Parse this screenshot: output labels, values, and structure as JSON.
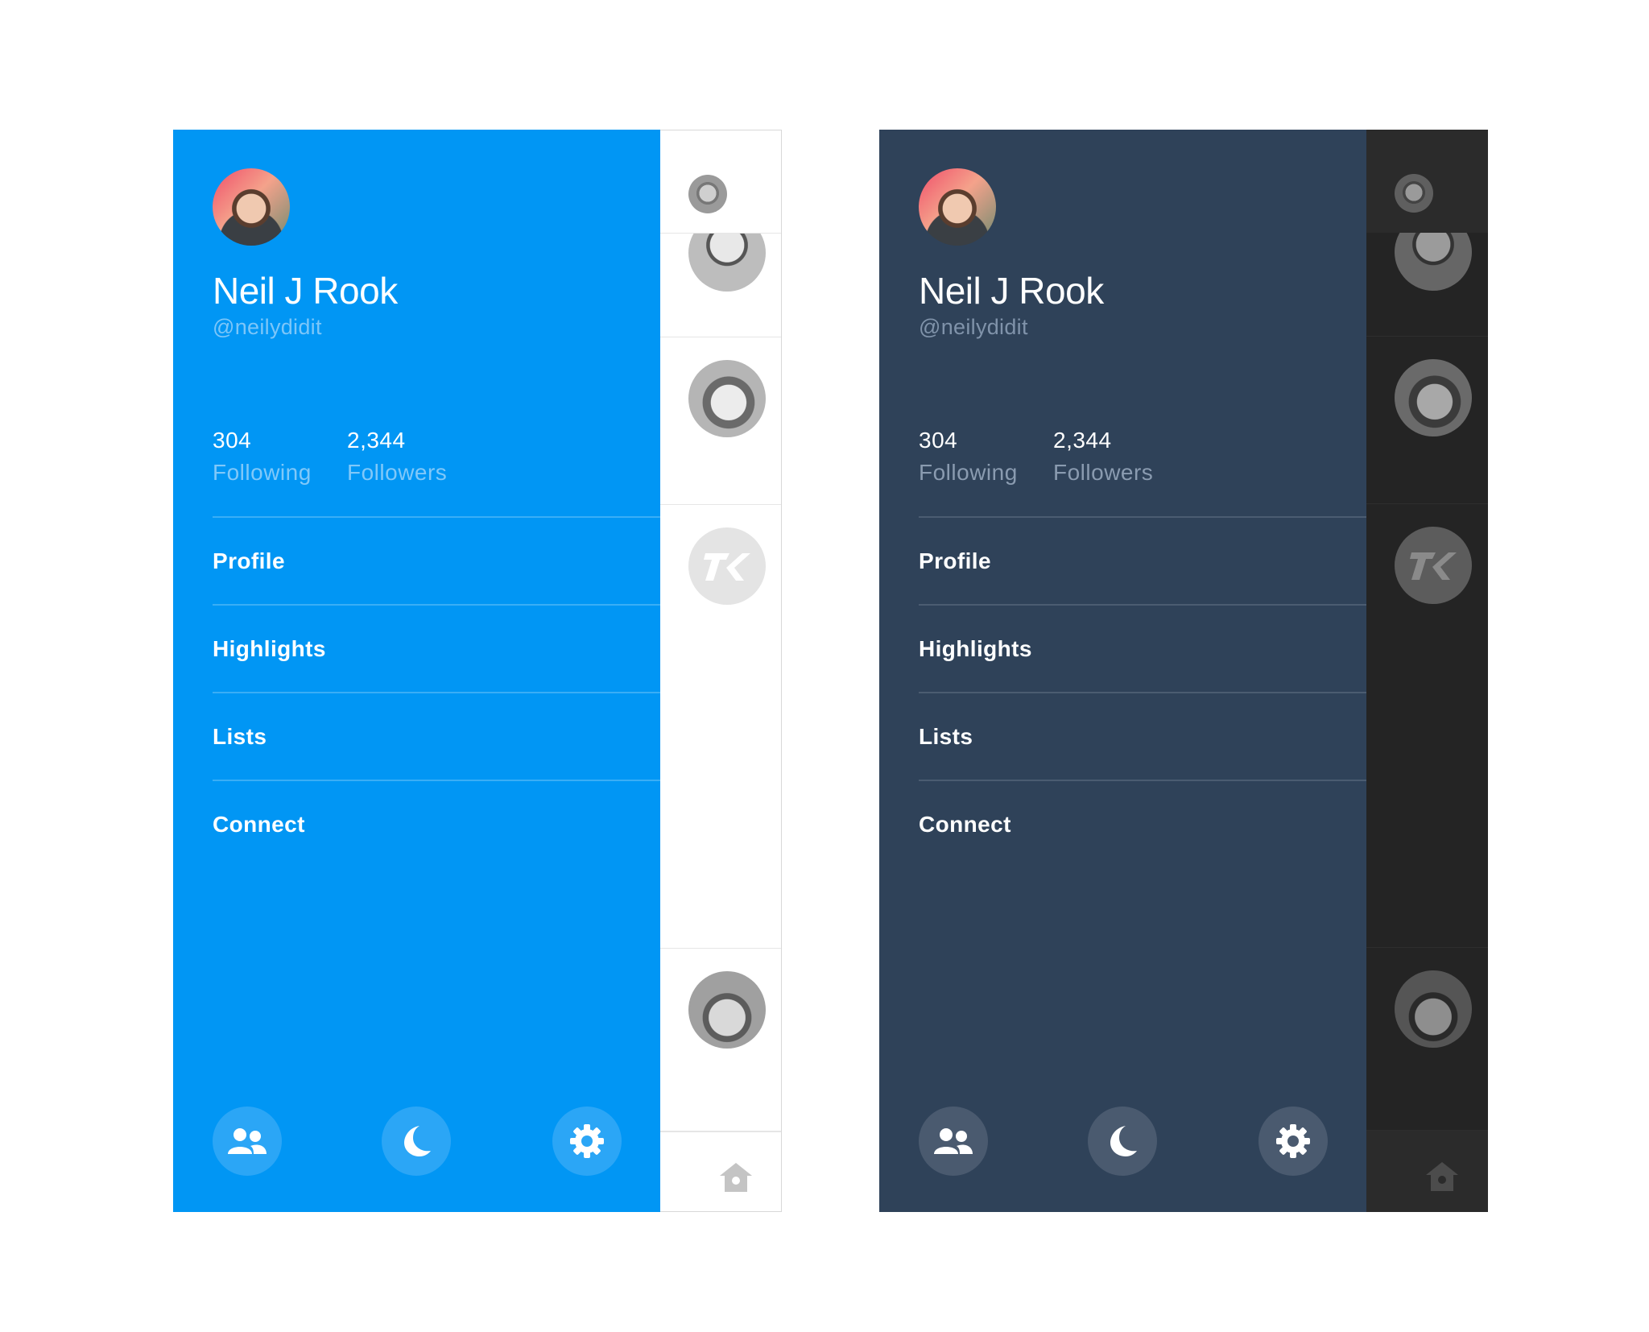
{
  "themes": {
    "light": {
      "drawer_color": "#0196f4",
      "strip_color": "#ffffff"
    },
    "dark": {
      "drawer_color": "#2f4259",
      "strip_color": "#242424"
    }
  },
  "profile": {
    "name": "Neil J Rook",
    "handle": "@neilydidit",
    "following_count": "304",
    "following_label": "Following",
    "followers_count": "2,344",
    "followers_label": "Followers"
  },
  "menu": {
    "items": [
      {
        "label": "Profile"
      },
      {
        "label": "Highlights"
      },
      {
        "label": "Lists"
      },
      {
        "label": "Connect"
      }
    ]
  },
  "footer": {
    "icons": [
      "accounts-icon",
      "night-mode-icon",
      "settings-icon"
    ]
  },
  "timeline_strip": {
    "icons": [
      "avatar",
      "avatar",
      "avatar",
      "twitterrific-k-logo",
      "avatar",
      "home-icon"
    ]
  }
}
